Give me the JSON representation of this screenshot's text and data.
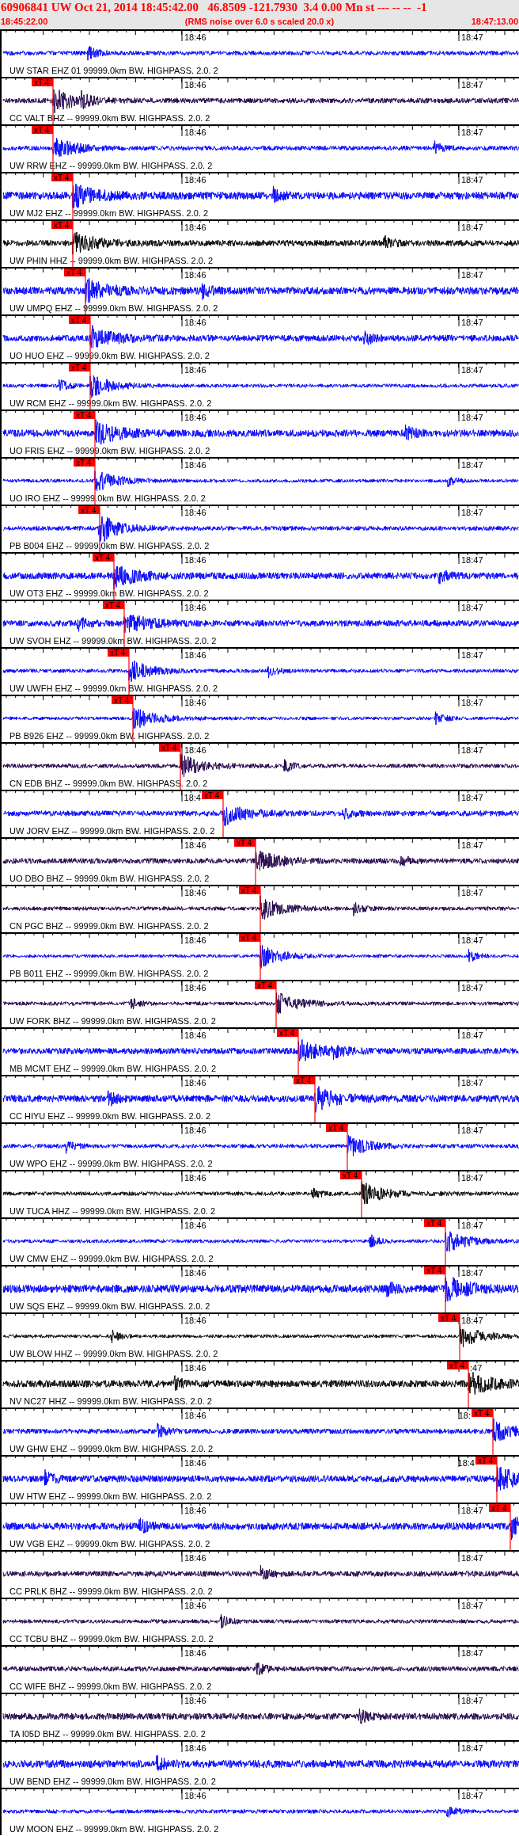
{
  "header": {
    "title": "60906841 UW Oct 21, 2014 18:45:42.00   46.8509 -121.7930  3.4 0.00 Mn st --- -- --  -1",
    "start_time": "18:45:22.00",
    "note": "(RMS noise over 6.0 s scaled 20.0 x)",
    "end_time": "18:47:13.00"
  },
  "traces": [
    {
      "label": "UW STAR EHZ 01 99999.0km BW. HIGHPASS. 2.0. 2",
      "color": "#0000ff",
      "time_labels": [
        "18:46",
        "18:47"
      ]
    },
    {
      "label": "CC VALT BHZ -- 99999.0km BW. HIGHPASS. 2.0. 2",
      "color": "#200048",
      "time_labels": [
        "18:46",
        "18:47"
      ],
      "pick": "xT 4"
    },
    {
      "label": "UW RRW EHZ -- 99999.0km BW. HIGHPASS. 2.0. 2",
      "color": "#0000ff",
      "time_labels": [
        "18:46",
        "18:47"
      ],
      "pick": "xT 4"
    },
    {
      "label": "UW MJ2 EHZ -- 99999.0km BW. HIGHPASS. 2.0. 2",
      "color": "#0000ff",
      "time_labels": [
        "18:46",
        "18:47"
      ],
      "pick": "xT 4"
    },
    {
      "label": "UW PHIN HHZ -- 99999.0km BW. HIGHPASS. 2.0. 2",
      "color": "#000000",
      "time_labels": [
        "18:46",
        "18:47"
      ],
      "pick": "xT 4"
    },
    {
      "label": "UW UMPQ EHZ -- 99999.0km BW. HIGHPASS. 2.0. 2",
      "color": "#0000ff",
      "time_labels": [
        "18:46",
        "18:47"
      ],
      "pick": "xT 4"
    },
    {
      "label": "UO HUO EHZ -- 99999.0km BW. HIGHPASS. 2.0. 2",
      "color": "#0000ff",
      "time_labels": [
        "18:46",
        "18:47"
      ],
      "pick": "xT 4"
    },
    {
      "label": "UW RCM EHZ -- 99999.0km BW. HIGHPASS. 2.0. 2",
      "color": "#0000ff",
      "time_labels": [
        "18:46",
        "18:47"
      ],
      "pick": "xT 4"
    },
    {
      "label": "UO FRIS EHZ -- 99999.0km BW. HIGHPASS. 2.0. 2",
      "color": "#0000ff",
      "time_labels": [
        "18:46",
        "18:47"
      ],
      "pick": "xT 4"
    },
    {
      "label": "UO IRO EHZ -- 99999.0km BW. HIGHPASS. 2.0. 2",
      "color": "#0000ff",
      "time_labels": [
        "18:46",
        "18:47"
      ],
      "pick": "xT 4"
    },
    {
      "label": "PB B004 EHZ -- 99999.0km BW. HIGHPASS. 2.0. 2",
      "color": "#0000ff",
      "time_labels": [
        "18:46",
        "18:47"
      ],
      "pick": "xT 4"
    },
    {
      "label": "UW OT3 EHZ -- 99999.0km BW. HIGHPASS. 2.0. 2",
      "color": "#0000ff",
      "time_labels": [
        "18:46",
        "18:47"
      ],
      "pick": "xT 4"
    },
    {
      "label": "UW SVOH EHZ -- 99999.0km BW. HIGHPASS. 2.0. 2",
      "color": "#0000ff",
      "time_labels": [
        "18:46",
        "18:47"
      ],
      "pick": "xT 4"
    },
    {
      "label": "UW UWFH EHZ -- 99999.0km BW. HIGHPASS. 2.0. 2",
      "color": "#0000ff",
      "time_labels": [
        "18:46",
        "18:47"
      ],
      "pick": "xT 4"
    },
    {
      "label": "PB B926 EHZ -- 99999.0km BW. HIGHPASS. 2.0. 2",
      "color": "#0000ff",
      "time_labels": [
        "18:46",
        "18:47"
      ],
      "pick": "xT 4"
    },
    {
      "label": "CN EDB BHZ -- 99999.0km BW. HIGHPASS. 2.0. 2",
      "color": "#200048",
      "time_labels": [
        "18:46",
        "18:47"
      ],
      "pick": "xT 4"
    },
    {
      "label": "UW JORV EHZ -- 99999.0km BW. HIGHPASS. 2.0. 2",
      "color": "#0000ff",
      "time_labels": [
        "18:4",
        "18:47"
      ],
      "pick": "xT 4"
    },
    {
      "label": "UO DBO BHZ -- 99999.0km BW. HIGHPASS. 2.0. 2",
      "color": "#200048",
      "time_labels": [
        "18:46",
        "18:47"
      ],
      "pick": "xT 4"
    },
    {
      "label": "CN PGC BHZ -- 99999.0km BW. HIGHPASS. 2.0. 2",
      "color": "#200048",
      "time_labels": [
        "18:46",
        "18:47"
      ],
      "pick": "xT 4"
    },
    {
      "label": "PB B011 EHZ -- 99999.0km BW. HIGHPASS. 2.0. 2",
      "color": "#0000ff",
      "time_labels": [
        "18:46",
        "18:47"
      ],
      "pick": "xT 4"
    },
    {
      "label": "UW FORK BHZ -- 99999.0km BW. HIGHPASS. 2.0. 2",
      "color": "#200048",
      "time_labels": [
        "18:46",
        "18:47"
      ],
      "pick": "xT 4"
    },
    {
      "label": "MB MCMT EHZ -- 99999.0km BW. HIGHPASS. 2.0. 2",
      "color": "#0000ff",
      "time_labels": [
        "18:46",
        "18:47"
      ],
      "pick": "xT 4"
    },
    {
      "label": "CC HIYU EHZ -- 99999.0km BW. HIGHPASS. 2.0. 2",
      "color": "#0000ff",
      "time_labels": [
        "18:46",
        "18:47"
      ],
      "pick": "xT 4"
    },
    {
      "label": "UW WPO EHZ -- 99999.0km BW. HIGHPASS. 2.0. 2",
      "color": "#0000ff",
      "time_labels": [
        "18:46",
        "18:47"
      ],
      "pick": "xT 4"
    },
    {
      "label": "UW TUCA HHZ -- 99999.0km BW. HIGHPASS. 2.0. 2",
      "color": "#000000",
      "time_labels": [
        "18:46",
        "18:47"
      ],
      "pick": "xT 4"
    },
    {
      "label": "UW CMW EHZ -- 99999.0km BW. HIGHPASS. 2.0. 2",
      "color": "#0000ff",
      "time_labels": [
        "18:46",
        "18:47"
      ],
      "pick": "xT 4"
    },
    {
      "label": "UW SQS EHZ -- 99999.0km BW. HIGHPASS. 2.0. 2",
      "color": "#0000ff",
      "time_labels": [
        "18:46",
        "18:47"
      ],
      "pick": "xT 4"
    },
    {
      "label": "UW BLOW HHZ -- 99999.0km BW. HIGHPASS. 2.0. 2",
      "color": "#000000",
      "time_labels": [
        "18:46",
        "18:47"
      ],
      "pick": "xT 4"
    },
    {
      "label": "NV NC27 HHZ -- 99999.0km BW. HIGHPASS. 2.0. 2",
      "color": "#000000",
      "time_labels": [
        "18:46",
        ":47"
      ],
      "pick": "xT 4"
    },
    {
      "label": "UW GHW EHZ -- 99999.0km BW. HIGHPASS. 2.0. 2",
      "color": "#0000ff",
      "time_labels": [
        "18:46",
        "18:"
      ],
      "pick": "xT 4"
    },
    {
      "label": "UW HTW EHZ -- 99999.0km BW. HIGHPASS. 2.0. 2",
      "color": "#0000ff",
      "time_labels": [
        "18:46",
        "18:4"
      ],
      "pick": "xT 4"
    },
    {
      "label": "UW VGB EHZ -- 99999.0km BW. HIGHPASS. 2.0. 2",
      "color": "#0000ff",
      "time_labels": [
        "18:46",
        "18:47"
      ],
      "pick": "xT 4"
    },
    {
      "label": "CC PRLK BHZ -- 99999.0km BW. HIGHPASS. 2.0. 2",
      "color": "#200048",
      "time_labels": [
        "18:46",
        "18:47"
      ]
    },
    {
      "label": "CC TCBU BHZ -- 99999.0km BW. HIGHPASS. 2.0. 2",
      "color": "#200048",
      "time_labels": [
        "18:46",
        "18:47"
      ]
    },
    {
      "label": "CC WIFE BHZ -- 99999.0km BW. HIGHPASS. 2.0. 2",
      "color": "#200048",
      "time_labels": [
        "18:46",
        "18:47"
      ]
    },
    {
      "label": "TA I05D BHZ -- 99999.0km BW. HIGHPASS. 2.0. 2",
      "color": "#200048",
      "time_labels": [
        "18:46",
        "18:47"
      ]
    },
    {
      "label": "UW BEND EHZ -- 99999.0km BW. HIGHPASS. 2.0. 2",
      "color": "#0000ff",
      "time_labels": [
        "18:46",
        "18:47"
      ]
    },
    {
      "label": "UW MOON EHZ -- 99999.0km BW. HIGHPASS. 2.0. 2",
      "color": "#0000ff",
      "time_labels": [
        "18:46",
        "18:47"
      ]
    }
  ]
}
